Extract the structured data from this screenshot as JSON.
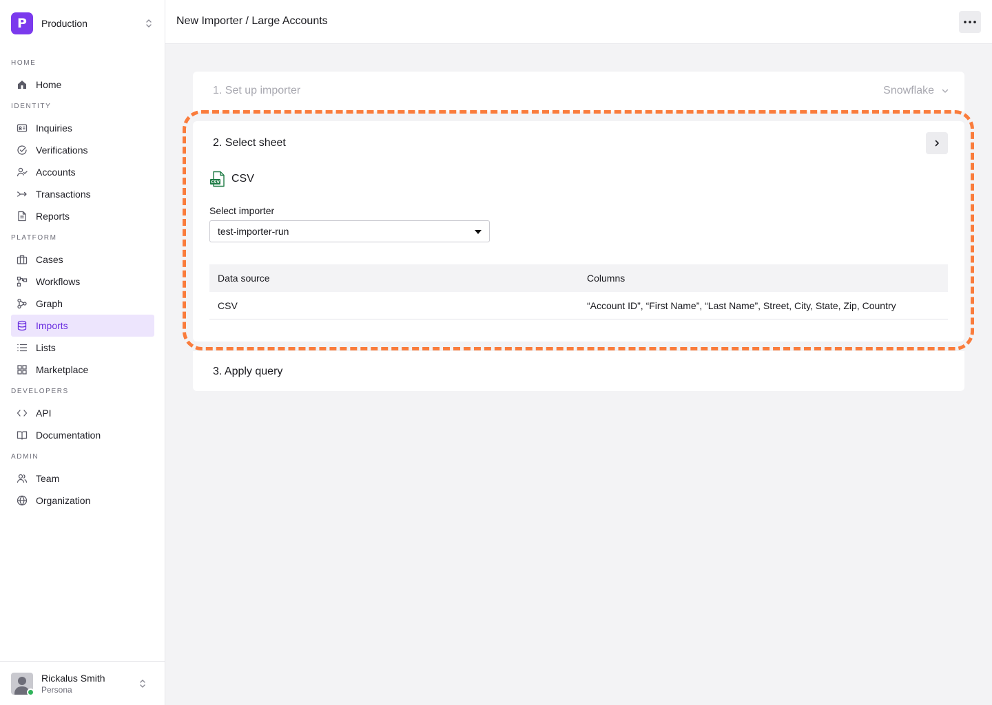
{
  "workspace": {
    "logo_letter": "P",
    "name": "Production"
  },
  "nav": {
    "home_section": "HOME",
    "home": "Home",
    "identity_section": "IDENTITY",
    "inquiries": "Inquiries",
    "verifications": "Verifications",
    "accounts": "Accounts",
    "transactions": "Transactions",
    "reports": "Reports",
    "platform_section": "PLATFORM",
    "cases": "Cases",
    "workflows": "Workflows",
    "graph": "Graph",
    "imports": "Imports",
    "lists": "Lists",
    "marketplace": "Marketplace",
    "developers_section": "DEVELOPERS",
    "api": "API",
    "documentation": "Documentation",
    "admin_section": "ADMIN",
    "team": "Team",
    "organization": "Organization",
    "active_item": "Imports"
  },
  "user": {
    "name": "Rickalus Smith",
    "org": "Persona",
    "status": "online"
  },
  "header": {
    "breadcrumb": "New Importer / Large Accounts"
  },
  "steps": {
    "step1": {
      "title": "1. Set up importer",
      "source": "Snowflake"
    },
    "step2": {
      "title": "2. Select sheet",
      "file_type": "CSV",
      "file_icon_label": "CSV",
      "select_label": "Select importer",
      "select_value": "test-importer-run",
      "table": {
        "headers": [
          "Data source",
          "Columns"
        ],
        "rows": [
          [
            "CSV",
            "“Account ID”, “First Name”, “Last Name”, Street, City, State, Zip, Country"
          ]
        ]
      }
    },
    "step3": {
      "title": "3. Apply query"
    }
  },
  "colors": {
    "brand": "#7b3aed",
    "active_nav_bg": "#ede5fd",
    "highlight": "#fa7c3c",
    "online": "#2fb35a"
  }
}
